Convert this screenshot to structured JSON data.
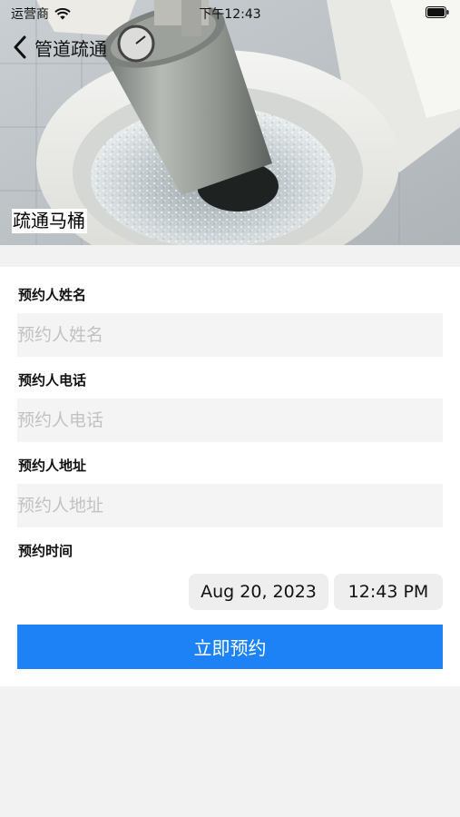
{
  "status_bar": {
    "carrier": "运营商",
    "time": "下午12:43"
  },
  "nav": {
    "title": "管道疏通",
    "back_icon": "chevron-left-icon"
  },
  "hero": {
    "caption": "疏通马桶"
  },
  "form": {
    "name": {
      "label": "预约人姓名",
      "placeholder": "预约人姓名",
      "value": ""
    },
    "phone": {
      "label": "预约人电话",
      "placeholder": "预约人电话",
      "value": ""
    },
    "address": {
      "label": "预约人地址",
      "placeholder": "预约人地址",
      "value": ""
    },
    "time": {
      "label": "预约时间",
      "date": "Aug 20, 2023",
      "clock": "12:43 PM"
    },
    "submit_label": "立即预约"
  },
  "colors": {
    "accent": "#1c82f5",
    "background": "#f2f2f2",
    "input_background": "#f4f4f4",
    "chip_background": "#eeeeef"
  }
}
